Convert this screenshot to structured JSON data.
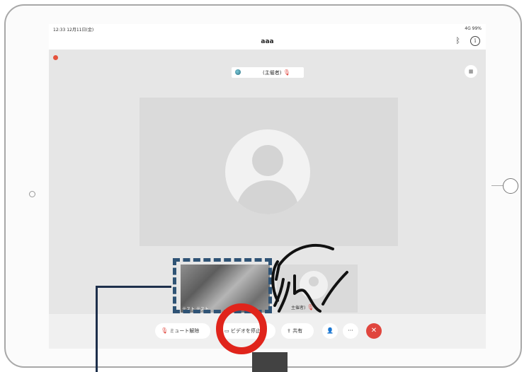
{
  "status_bar": {
    "time": "12:33",
    "date": "12月11日(金)",
    "battery_text": "4G 99%"
  },
  "nav": {
    "title": "aaa"
  },
  "host_label": "(主催者)",
  "self_thumbnail": {
    "name": "テスト テスト"
  },
  "other_thumbnail": {
    "name": "主催者)"
  },
  "toolbar": {
    "mute_label": "ミュート解除",
    "video_label": "ビデオを停止",
    "share_label": "共有",
    "more_label": "···"
  },
  "colors": {
    "end_button": "#e0463e",
    "annotation_ring": "#e0241b",
    "dash_box": "#2f5375"
  }
}
